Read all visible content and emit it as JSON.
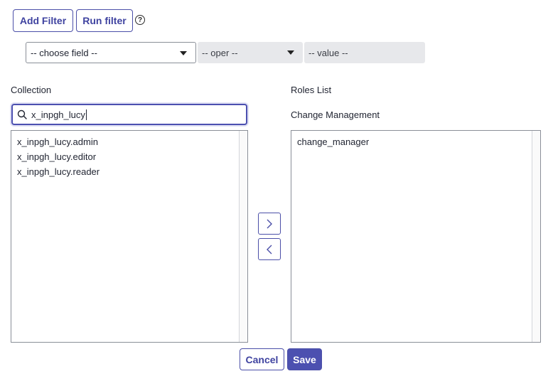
{
  "toolbar": {
    "add_filter_label": "Add Filter",
    "run_filter_label": "Run filter",
    "help_icon": "?"
  },
  "filter": {
    "field_value": "-- choose field --",
    "oper_value": "-- oper --",
    "value_placeholder": "-- value --"
  },
  "collection": {
    "label": "Collection",
    "search_value": "x_inpgh_lucy",
    "items": [
      "x_inpgh_lucy.admin",
      "x_inpgh_lucy.editor",
      "x_inpgh_lucy.reader"
    ]
  },
  "roles": {
    "label": "Roles List",
    "group_label": "Change Management",
    "items": [
      "change_manager"
    ]
  },
  "move": {
    "right_icon": "chevron-right-icon",
    "left_icon": "chevron-left-icon"
  },
  "footer": {
    "cancel_label": "Cancel",
    "save_label": "Save"
  },
  "colors": {
    "accent": "#4c50b0",
    "field_grey": "#e7e8eb"
  }
}
